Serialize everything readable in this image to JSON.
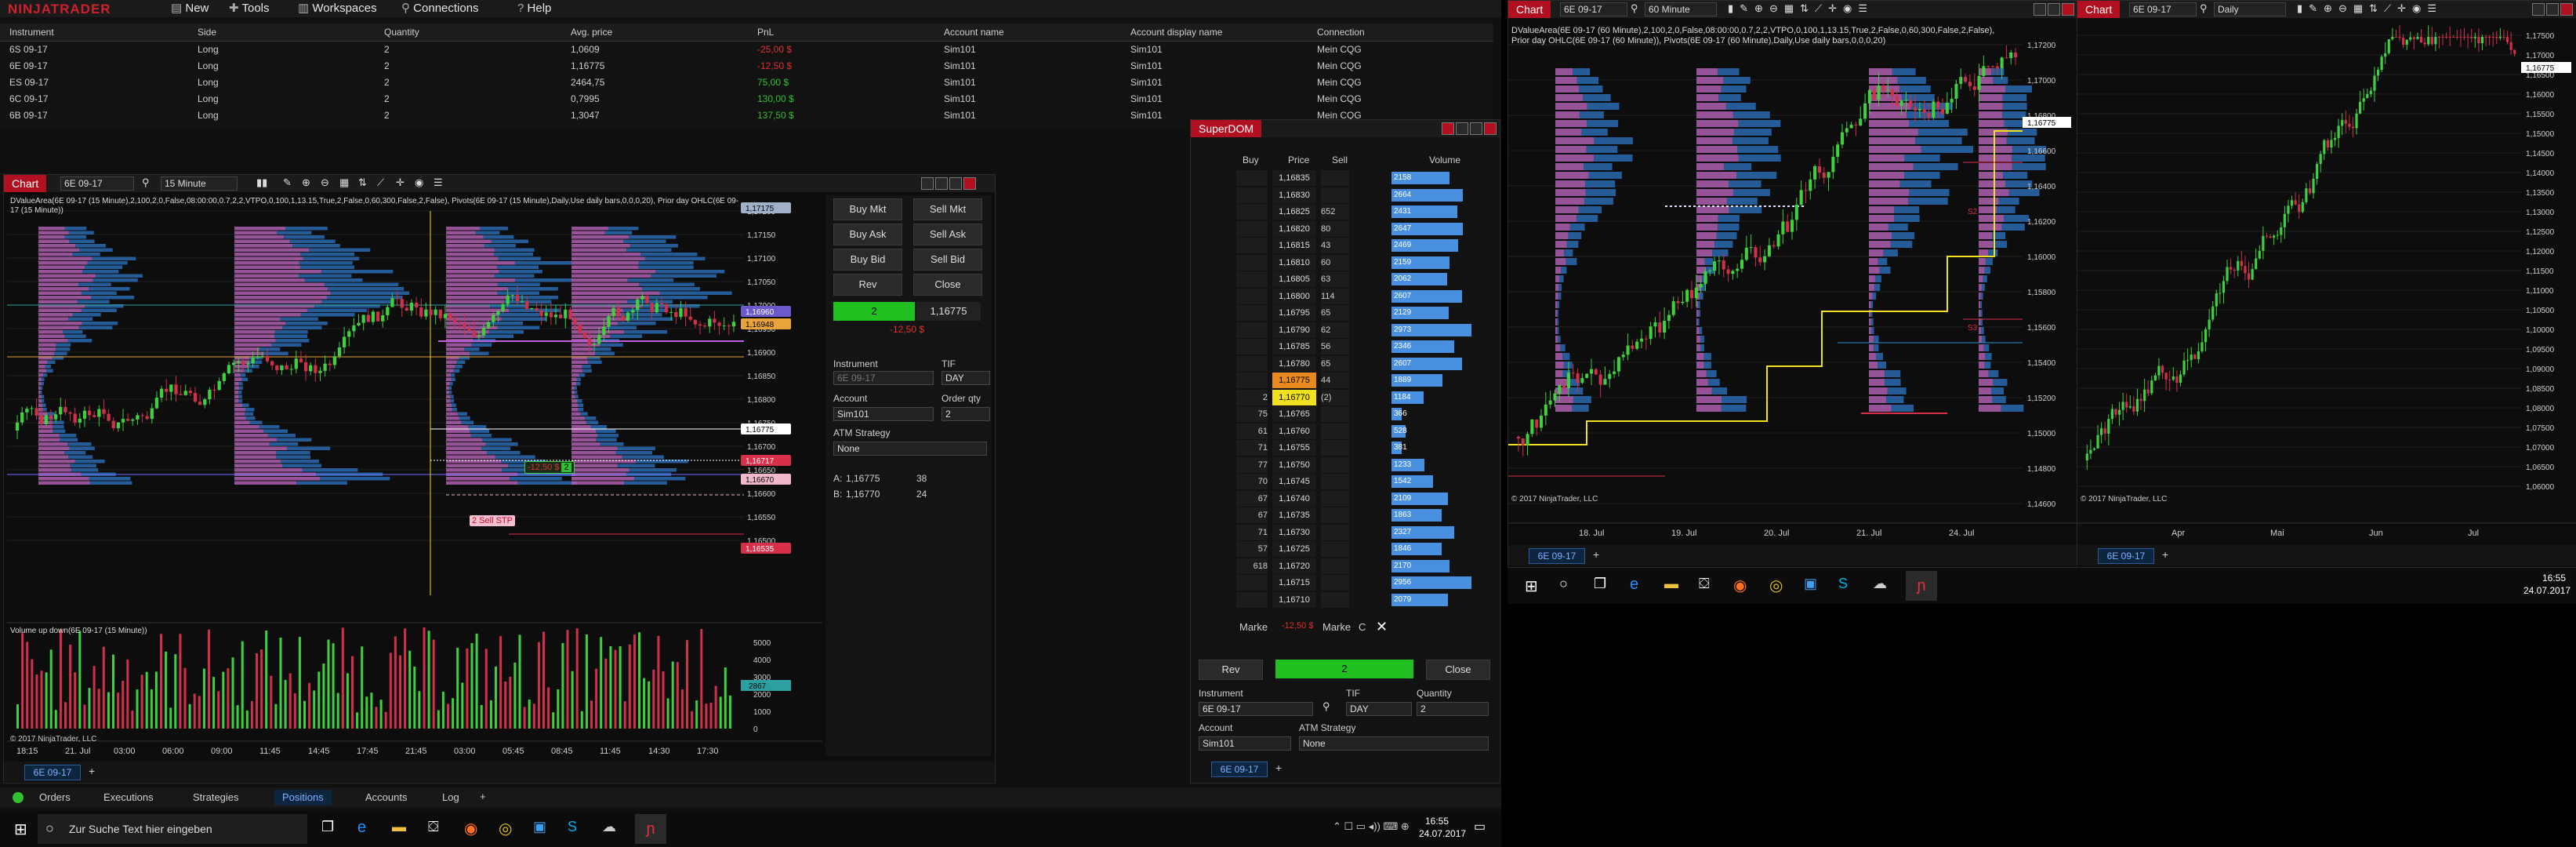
{
  "menubar": {
    "logo": "NINJATRADER",
    "items": [
      "New",
      "Tools",
      "Workspaces",
      "Connections",
      "Help"
    ]
  },
  "positions": {
    "headers": [
      "Instrument",
      "Side",
      "Quantity",
      "Avg. price",
      "PnL",
      "Account name",
      "Account display name",
      "Connection"
    ],
    "rows": [
      [
        "6S 09-17",
        "Long",
        "2",
        "1,0609",
        "-25,00 $",
        "Sim101",
        "Sim101",
        "Mein CQG"
      ],
      [
        "6E 09-17",
        "Long",
        "2",
        "1,16775",
        "-12,50 $",
        "Sim101",
        "Sim101",
        "Mein CQG"
      ],
      [
        "ES 09-17",
        "Long",
        "2",
        "2464,75",
        "75,00 $",
        "Sim101",
        "Sim101",
        "Mein CQG"
      ],
      [
        "6C 09-17",
        "Long",
        "2",
        "0,7995",
        "130,00 $",
        "Sim101",
        "Sim101",
        "Mein CQG"
      ],
      [
        "6B 09-17",
        "Long",
        "2",
        "1,3047",
        "137,50 $",
        "Sim101",
        "Sim101",
        "Mein CQG"
      ]
    ],
    "pnl_colors": [
      "#e03030",
      "#e03030",
      "#30c030",
      "#30c030",
      "#30c030"
    ]
  },
  "chart1": {
    "tab": "Chart",
    "instrument": "6E 09-17",
    "interval": "15 Minute",
    "indicator_text": "DValueArea(6E 09-17 (15 Minute),2,100,2,0,False,08:00:00,0.7,2,2,VTPO,0,100,1,13.15,True,2,False,0,60,300,False,2,False), Pivots(6E 09-17 (15 Minute),Daily,Use daily bars,0,0,0,20), Prior day OHLC(6E 09-17 (15 Minute))",
    "volume_label": "Volume up down(6E 09-17 (15 Minute))",
    "copyright": "© 2017 NinjaTrader, LLC",
    "price_labels": [
      "1,17200",
      "1,17150",
      "1,17100",
      "1,17050",
      "1,17000",
      "1,16950",
      "1,16900",
      "1,16850",
      "1,16800",
      "1,16750",
      "1,16700",
      "1,16650",
      "1,16600",
      "1,16550",
      "1,16500"
    ],
    "price_tags": [
      {
        "text": "1,17175",
        "color": "#9fb0c8"
      },
      {
        "text": "1,16960",
        "color": "#6a5acd"
      },
      {
        "text": "1,16948",
        "color": "#e8a33a"
      },
      {
        "text": "1,16775",
        "color": "#ffffff"
      },
      {
        "text": "1,16717",
        "color": "#d8304a"
      },
      {
        "text": "1,16670",
        "color": "#f0b8c8"
      },
      {
        "text": "1,16535",
        "color": "#d8304a"
      }
    ],
    "volume_labels": [
      "5000",
      "4000",
      "3000",
      "2000",
      "1000",
      "0"
    ],
    "volume_tag": "2867",
    "time_labels": [
      "18:15",
      "21. Jul",
      "03:00",
      "06:00",
      "09:00",
      "11:45",
      "14:45",
      "17:45",
      "21:45",
      "03:00",
      "05:45",
      "08:45",
      "11:45",
      "14:30",
      "17:30"
    ],
    "position_badge_pnl": "-12,50 $",
    "position_badge_qty": "2",
    "stop_label": "2  Sell STP",
    "footer_tab": "6E 09-17"
  },
  "chart_trader": {
    "buttons": [
      "Buy Mkt",
      "Sell Mkt",
      "Buy Ask",
      "Sell Ask",
      "Buy Bid",
      "Sell Bid",
      "Rev",
      "Close"
    ],
    "position_qty": "2",
    "position_price": "1,16775",
    "position_pnl": "-12,50 $",
    "instrument_label": "Instrument",
    "tif_label": "TIF",
    "instrument_value": "6E 09-17",
    "tif_value": "DAY",
    "account_label": "Account",
    "order_qty_label": "Order qty",
    "account_value": "Sim101",
    "order_qty_value": "2",
    "atm_label": "ATM Strategy",
    "atm_value": "None",
    "ask_label": "A:",
    "ask_price": "1,16775",
    "ask_size": "38",
    "bid_label": "B:",
    "bid_price": "1,16770",
    "bid_size": "24"
  },
  "superdom": {
    "title": "SuperDOM",
    "headers": [
      "Buy",
      "Price",
      "Sell",
      "Volume"
    ],
    "rows": [
      {
        "buy": "",
        "price": "1,16835",
        "sell": "",
        "vol": "2158",
        "w": 0.62
      },
      {
        "buy": "",
        "price": "1,16830",
        "sell": "",
        "vol": "2664",
        "w": 0.76
      },
      {
        "buy": "",
        "price": "1,16825",
        "sell": "652",
        "vol": "2431",
        "w": 0.7
      },
      {
        "buy": "",
        "price": "1,16820",
        "sell": "80",
        "vol": "2647",
        "w": 0.76
      },
      {
        "buy": "",
        "price": "1,16815",
        "sell": "43",
        "vol": "2469",
        "w": 0.71
      },
      {
        "buy": "",
        "price": "1,16810",
        "sell": "60",
        "vol": "2159",
        "w": 0.62
      },
      {
        "buy": "",
        "price": "1,16805",
        "sell": "63",
        "vol": "2062",
        "w": 0.59
      },
      {
        "buy": "",
        "price": "1,16800",
        "sell": "114",
        "vol": "2607",
        "w": 0.75
      },
      {
        "buy": "",
        "price": "1,16795",
        "sell": "65",
        "vol": "2129",
        "w": 0.61
      },
      {
        "buy": "",
        "price": "1,16790",
        "sell": "62",
        "vol": "2973",
        "w": 0.85
      },
      {
        "buy": "",
        "price": "1,16785",
        "sell": "56",
        "vol": "2346",
        "w": 0.67
      },
      {
        "buy": "",
        "price": "1,16780",
        "sell": "65",
        "vol": "2607",
        "w": 0.75
      },
      {
        "buy": "",
        "price": "1,16775",
        "sell": "44",
        "vol": "1889",
        "w": 0.54
      },
      {
        "buy": "2",
        "price": "1,16770",
        "sell": "(2)",
        "vol": "1184",
        "w": 0.34
      },
      {
        "buy": "75",
        "price": "1,16765",
        "sell": "",
        "vol": "366",
        "w": 0.11
      },
      {
        "buy": "61",
        "price": "1,16760",
        "sell": "",
        "vol": "528",
        "w": 0.15
      },
      {
        "buy": "71",
        "price": "1,16755",
        "sell": "",
        "vol": "381",
        "w": 0.11
      },
      {
        "buy": "77",
        "price": "1,16750",
        "sell": "",
        "vol": "1233",
        "w": 0.35
      },
      {
        "buy": "70",
        "price": "1,16745",
        "sell": "",
        "vol": "1542",
        "w": 0.44
      },
      {
        "buy": "67",
        "price": "1,16740",
        "sell": "",
        "vol": "2109",
        "w": 0.6
      },
      {
        "buy": "67",
        "price": "1,16735",
        "sell": "",
        "vol": "1863",
        "w": 0.53
      },
      {
        "buy": "71",
        "price": "1,16730",
        "sell": "",
        "vol": "2327",
        "w": 0.67
      },
      {
        "buy": "57",
        "price": "1,16725",
        "sell": "",
        "vol": "1846",
        "w": 0.53
      },
      {
        "buy": "618",
        "price": "1,16720",
        "sell": "",
        "vol": "2170",
        "w": 0.62
      },
      {
        "buy": "",
        "price": "1,16715",
        "sell": "",
        "vol": "2956",
        "w": 0.85
      },
      {
        "buy": "",
        "price": "1,16710",
        "sell": "",
        "vol": "2079",
        "w": 0.6
      }
    ],
    "footer_left": "Marke",
    "footer_pnl": "-12,50 $",
    "footer_right": "Marke",
    "footer_c": "C",
    "rev": "Rev",
    "pos_qty": "2",
    "close": "Close",
    "instrument_label": "Instrument",
    "tif_label": "TIF",
    "quantity_label": "Quantity",
    "instrument_value": "6E 09-17",
    "tif_value": "DAY",
    "quantity_value": "2",
    "account_label": "Account",
    "atm_label": "ATM Strategy",
    "account_value": "Sim101",
    "atm_value": "None",
    "footer_tab": "6E 09-17"
  },
  "chart2": {
    "tab": "Chart",
    "instrument": "6E 09-17",
    "interval": "60 Minute",
    "indicator_text": "DValueArea(6E 09-17 (60 Minute),2,100,2,0,False,08:00:00,0.7,2,2,VTPO,0,100,1,13.15,True,2,False,0,60,300,False,2,False), Prior day OHLC(6E 09-17 (60 Minute)), Pivots(6E 09-17 (60 Minute),Daily,Use daily bars,0,0,0,20)",
    "price_labels": [
      "1,17200",
      "1,17000",
      "1,16800",
      "1,16600",
      "1,16400",
      "1,16200",
      "1,16000",
      "1,15800",
      "1,15600",
      "1,15400",
      "1,15200",
      "1,15000",
      "1,14800",
      "1,14600"
    ],
    "price_tag": "1,16775",
    "red_labels": [
      "S2",
      "S3"
    ],
    "time_labels": [
      "18. Jul",
      "19. Jul",
      "20. Jul",
      "21. Jul",
      "24. Jul"
    ],
    "copyright": "© 2017 NinjaTrader, LLC",
    "footer_tab": "6E 09-17"
  },
  "chart3": {
    "tab": "Chart",
    "instrument": "6E 09-17",
    "interval": "Daily",
    "price_labels": [
      "1,17500",
      "1,17000",
      "1,16500",
      "1,16000",
      "1,15500",
      "1,15000",
      "1,14500",
      "1,14000",
      "1,13500",
      "1,13000",
      "1,12500",
      "1,12000",
      "1,11500",
      "1,11000",
      "1,10500",
      "1,10000",
      "1,09500",
      "1,09000",
      "1,08500",
      "1,08000",
      "1,07500",
      "1,07000",
      "1,06500",
      "1,06000"
    ],
    "price_tag": "1,16775",
    "time_labels": [
      "Apr",
      "Mai",
      "Jun",
      "Jul"
    ],
    "copyright": "© 2017 NinjaTrader, LLC",
    "footer_tab": "6E 09-17"
  },
  "bottom_tabs": [
    "Orders",
    "Executions",
    "Strategies",
    "Positions",
    "Accounts",
    "Log"
  ],
  "active_bottom_tab": "Positions",
  "taskbar": {
    "search_placeholder": "Zur Suche Text hier eingeben",
    "time": "16:55",
    "date": "24.07.2017"
  },
  "taskbar2": {
    "time": "16:55",
    "date": "24.07.2017"
  },
  "colors": {
    "accent_red": "#b01020",
    "candle_up": "#3fcf3f",
    "candle_down": "#d0304a",
    "profile_magenta": "#b060b0",
    "profile_blue": "#2a6ab0"
  }
}
